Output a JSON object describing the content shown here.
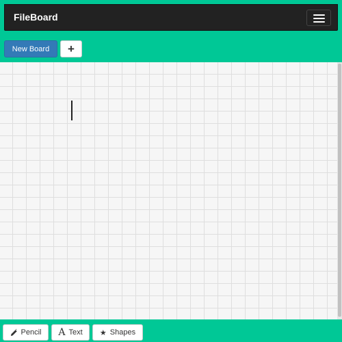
{
  "app": {
    "brand": "FileBoard"
  },
  "header": {
    "menu_icon": "hamburger-menu-icon"
  },
  "board_toolbar": {
    "new_board_label": "New Board",
    "add_icon": "plus-icon",
    "add_glyph": "+"
  },
  "canvas": {
    "grid": true
  },
  "tools": {
    "pencil": {
      "label": "Pencil",
      "icon": "pencil-icon"
    },
    "text": {
      "label": "Text",
      "icon": "text-icon",
      "glyph": "A"
    },
    "shapes": {
      "label": "Shapes",
      "icon": "star-icon",
      "glyph": "★"
    }
  },
  "colors": {
    "background": "#00c896",
    "navbar": "#222222",
    "primary": "#337ab7",
    "canvas": "#f6f6f6",
    "grid_line": "#dedede"
  }
}
